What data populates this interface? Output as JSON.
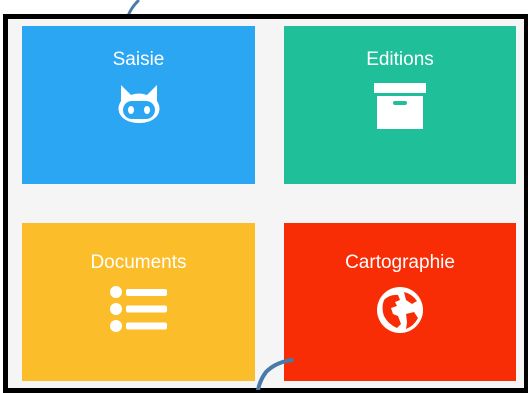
{
  "tiles": [
    {
      "label": "Saisie",
      "color": "#2aa6f2",
      "icon": "github-octocat-icon"
    },
    {
      "label": "Editions",
      "color": "#1fbf9a",
      "icon": "archive-box-icon"
    },
    {
      "label": "Documents",
      "color": "#fbbd29",
      "icon": "list-icon"
    },
    {
      "label": "Cartographie",
      "color": "#f92d05",
      "icon": "globe-icon"
    }
  ],
  "colors": {
    "frame_border": "#000000",
    "background": "#f5f5f5",
    "annotation_stroke": "#4a7aa8"
  }
}
